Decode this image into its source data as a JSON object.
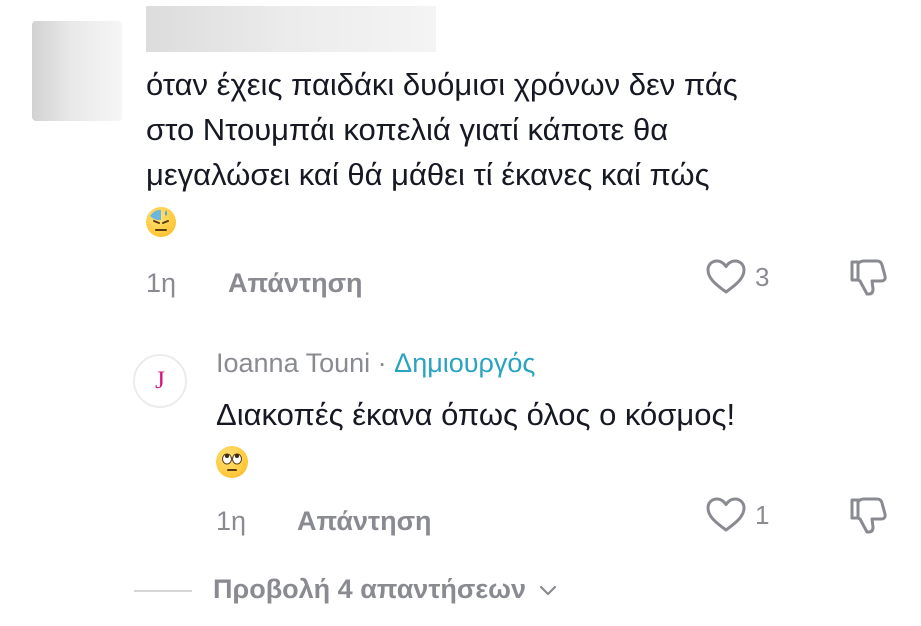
{
  "comment": {
    "lines": [
      "όταν έχεις παιδάκι δυόμισι χρόνων δεν πάς",
      "στο Ντουμπάι κοπελιά γιατί κάποτε θα",
      "μεγαλώσει καί θά μάθει τί έκανες καί πώς"
    ],
    "emoji": "downcast-sweat-face",
    "time": "1η",
    "reply_label": "Απάντηση",
    "likes": "3"
  },
  "reply": {
    "avatar_letter": "J",
    "author": "Ioanna Touni",
    "separator": " · ",
    "badge": "Δημιουργός",
    "text": "Διακοπές έκανα όπως όλος ο κόσμος!",
    "emoji": "eye-roll-face",
    "time": "1η",
    "reply_label": "Απάντηση",
    "likes": "1"
  },
  "view_replies": "Προβολή 4 απαντήσεων",
  "colors": {
    "text": "#161823",
    "muted": "#8a8b91",
    "creator": "#2aa3c2",
    "avatar_letter": "#d4147a"
  }
}
